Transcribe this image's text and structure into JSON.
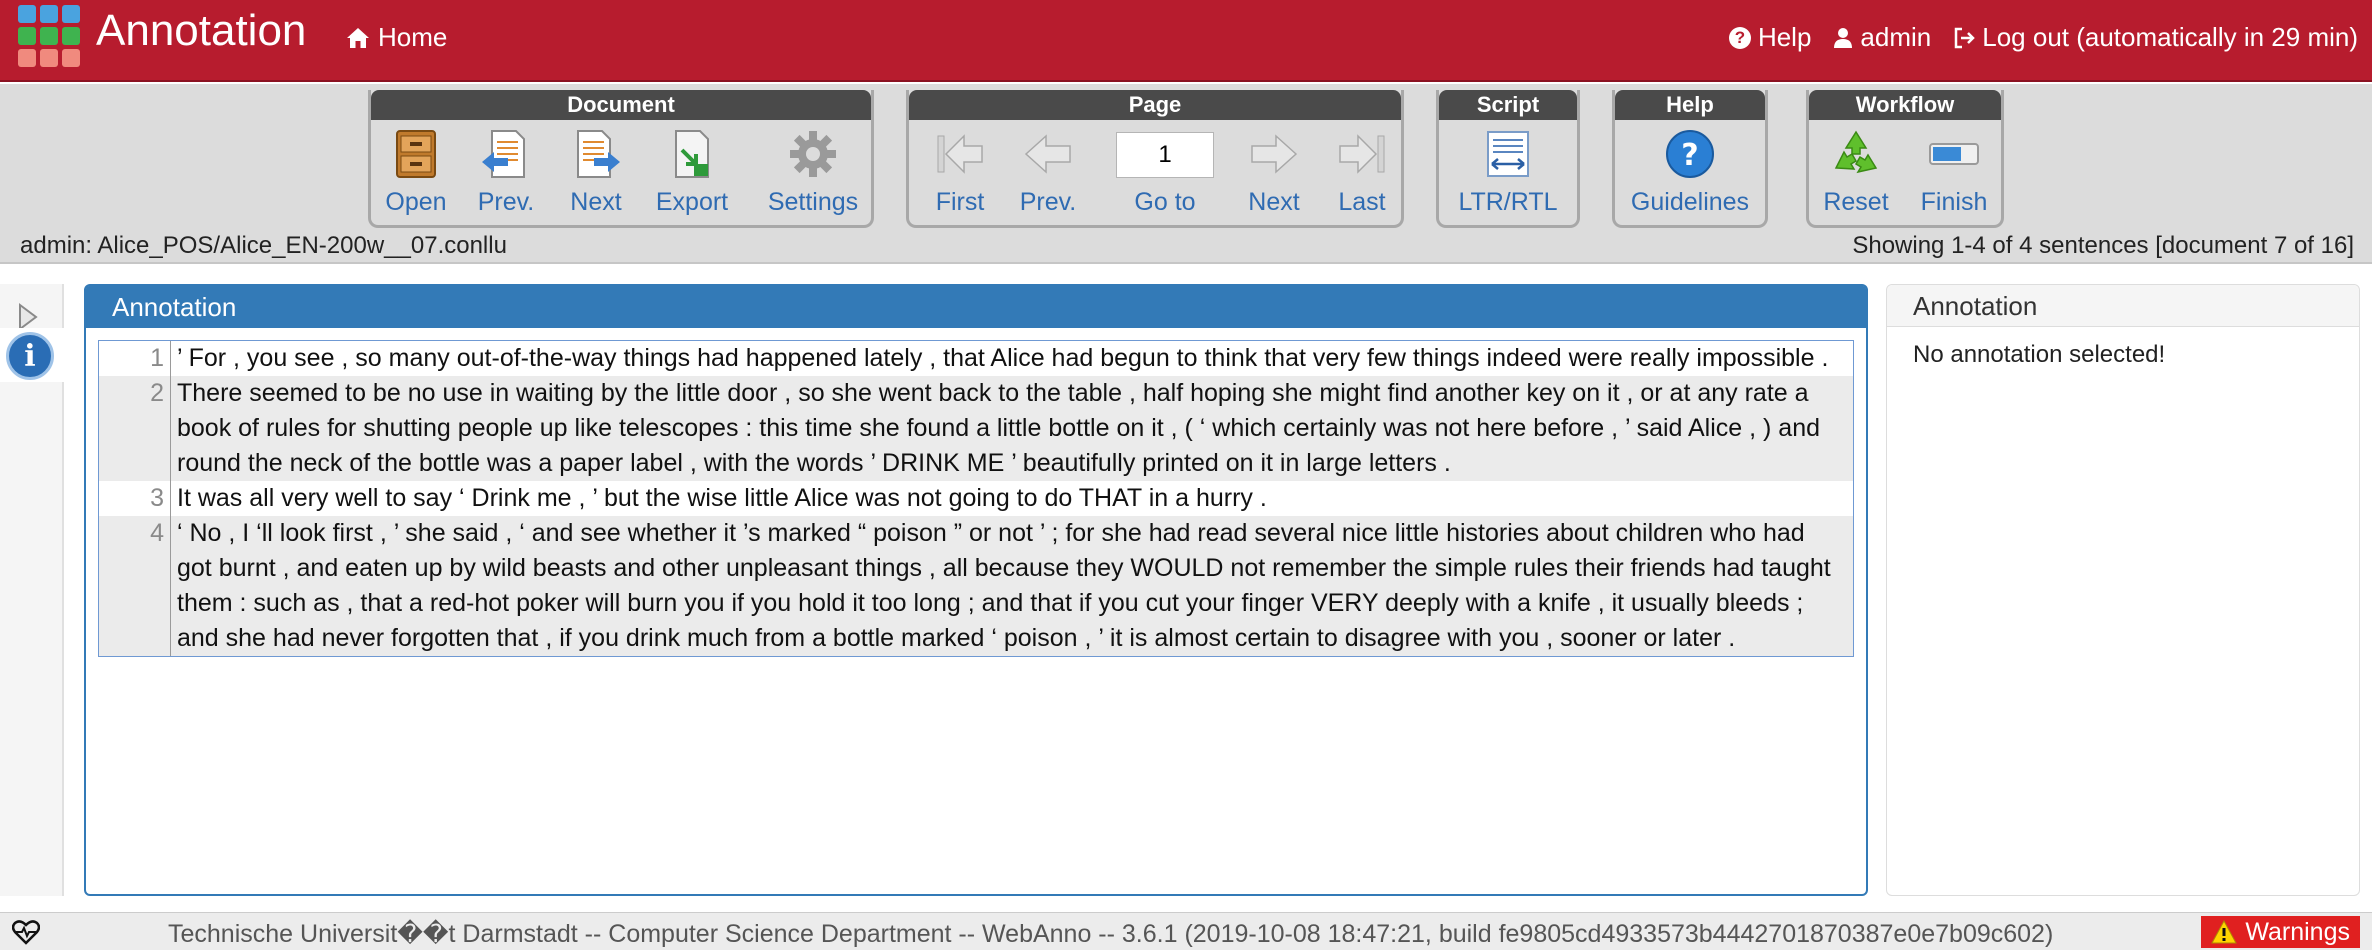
{
  "navbar": {
    "title": "Annotation",
    "home": "Home",
    "help": "Help",
    "user": "admin",
    "logout": "Log out (automatically in 29 min)"
  },
  "toolbar": {
    "document": {
      "label": "Document",
      "open": "Open",
      "prev": "Prev.",
      "next": "Next",
      "export": "Export",
      "settings": "Settings"
    },
    "page": {
      "label": "Page",
      "first": "First",
      "prev": "Prev.",
      "goto": "Go to",
      "next": "Next",
      "last": "Last",
      "current": "1"
    },
    "script": {
      "label": "Script",
      "ltr_rtl": "LTR/RTL"
    },
    "help": {
      "label": "Help",
      "guidelines": "Guidelines"
    },
    "workflow": {
      "label": "Workflow",
      "reset": "Reset",
      "finish": "Finish"
    }
  },
  "status": {
    "document_path": "admin: Alice_POS/Alice_EN-200w__07.conllu",
    "showing": "Showing 1-4 of 4 sentences [document 7 of 16]"
  },
  "annotation_panel": {
    "title": "Annotation",
    "sentences": [
      {
        "num": "1",
        "text": "’ For , you see , so many out-of-the-way things had happened lately , that Alice had begun to think that very few things indeed were really impossible ."
      },
      {
        "num": "2",
        "text": "There seemed to be no use in waiting by the little door , so she went back to the table , half hoping she might find another key on it , or at any rate a book of rules for shutting people up like telescopes : this time she found a little bottle on it , ( ‘ which certainly was not here before , ’ said Alice , ) and round the neck of the bottle was a paper label , with the words ’ DRINK ME ’ beautifully printed on it in large letters ."
      },
      {
        "num": "3",
        "text": "It was all very well to say ‘ Drink me , ’ but the wise little Alice was not going to do THAT in a hurry ."
      },
      {
        "num": "4",
        "text": "‘ No , I ‘ll look first , ’ she said , ‘ and see whether it ’s marked “ poison ” or not ’ ; for she had read several nice little histories about children who had got burnt , and eaten up by wild beasts and other unpleasant things , all because they WOULD not remember the simple rules their friends had taught them : such as , that a red-hot poker will burn you if you hold it too long ; and that if you cut your finger VERY deeply with a knife , it usually bleeds ; and she had never forgotten that , if you drink much from a bottle marked ‘ poison , ’ it is almost certain to disagree with you , sooner or later ."
      }
    ]
  },
  "right_panel": {
    "title": "Annotation",
    "empty": "No annotation selected!"
  },
  "footer": {
    "text": "Technische Universit��t Darmstadt -- Computer Science Department -- WebAnno -- 3.6.1 (2019-10-08 18:47:21, build fe9805cd4933573b4442701870387e0e7b09c602)",
    "warnings": "Warnings"
  },
  "colors": {
    "navbar": "#b71c2e",
    "accent": "#337ab7",
    "link": "#2f6bb2",
    "warning": "#e02020"
  }
}
